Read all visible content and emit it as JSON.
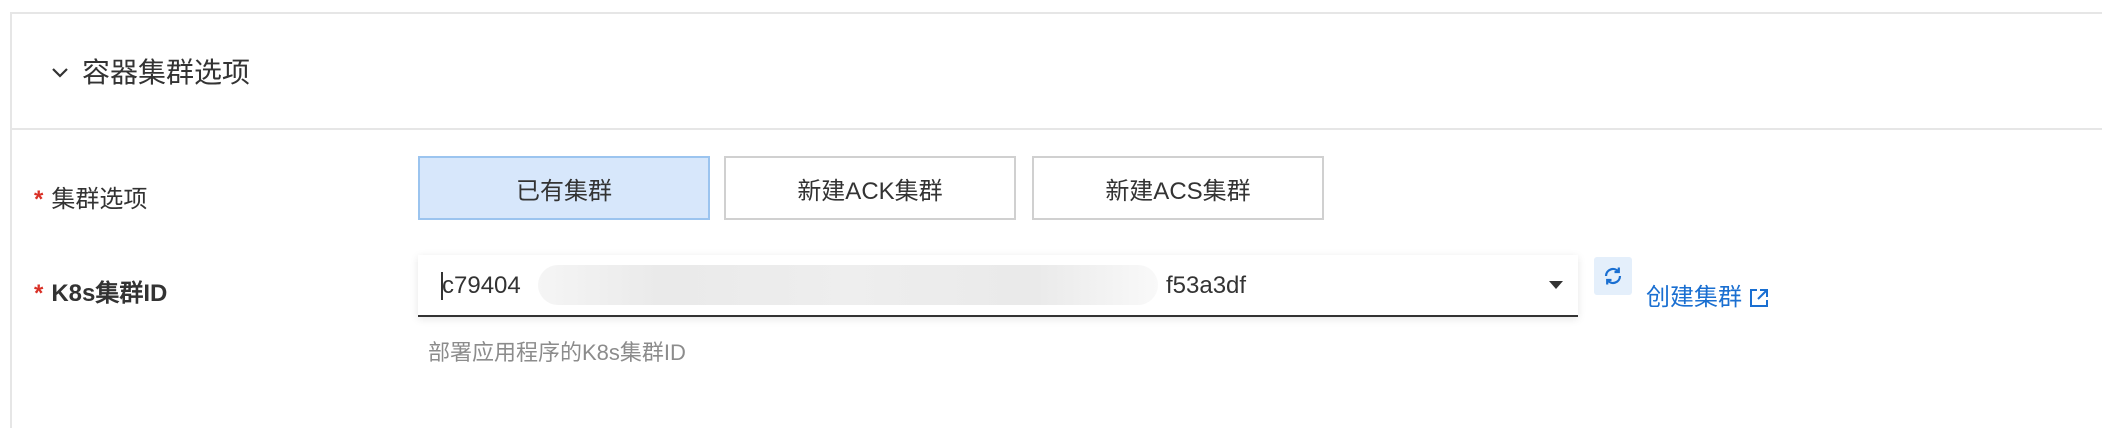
{
  "section": {
    "title": "容器集群选项",
    "chevron_icon": "chevron-down-icon"
  },
  "cluster_option": {
    "required_mark": "*",
    "label": "集群选项",
    "buttons": [
      {
        "label": "已有集群",
        "selected": true
      },
      {
        "label": "新建ACK集群",
        "selected": false
      },
      {
        "label": "新建ACS集群",
        "selected": false
      }
    ]
  },
  "k8s_cluster": {
    "required_mark": "*",
    "label": "K8s集群ID",
    "value_prefix": "c79404",
    "value_suffix": "f53a3df",
    "dropdown_icon": "caret-down-icon",
    "refresh_icon": "refresh-icon",
    "create_link": "创建集群",
    "create_link_icon": "external-link-icon",
    "help": "部署应用程序的K8s集群ID"
  },
  "colors": {
    "accent": "#1a6fd1",
    "required": "#d93026",
    "selected_bg": "#d7e7fb",
    "selected_border": "#9bc4ef"
  }
}
